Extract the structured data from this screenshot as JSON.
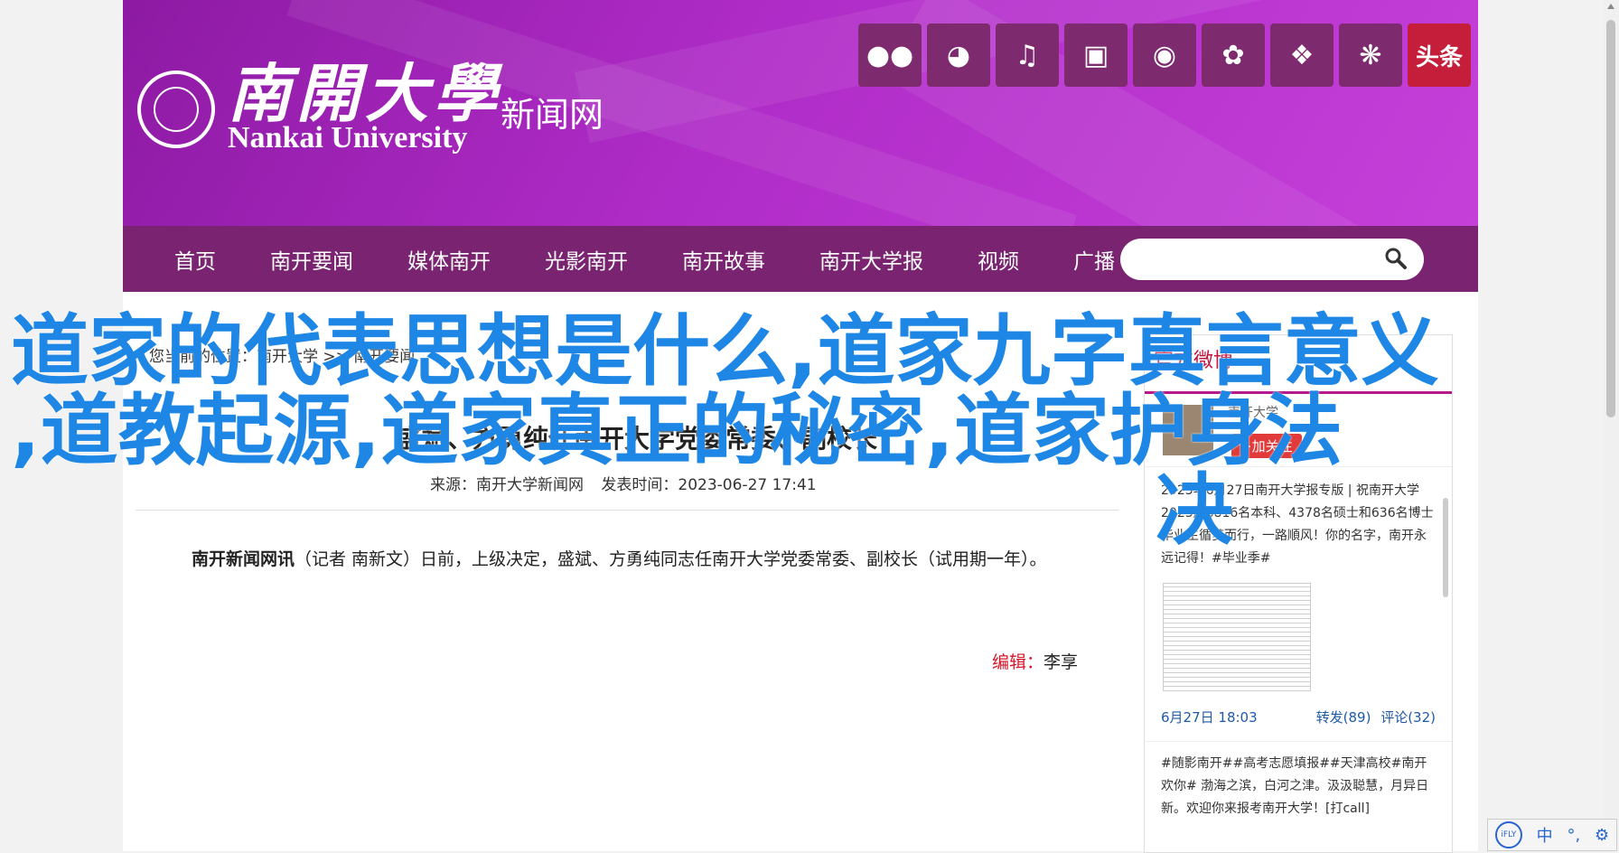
{
  "header": {
    "logo_cn": "南開大學",
    "logo_en": "Nankai University",
    "logo_sub": "新闻网",
    "social_icons": [
      "wechat-icon",
      "weibo-icon",
      "tiktok-icon",
      "bilibili-icon",
      "kuaishou-icon",
      "xuexi-icon",
      "dots-icon",
      "dandelion-icon",
      "toutiao-icon"
    ],
    "toutiao_label": "头条"
  },
  "nav": {
    "items": [
      "首页",
      "南开要闻",
      "媒体南开",
      "光影南开",
      "南开故事",
      "南开大学报",
      "视频",
      "广播"
    ],
    "search_placeholder": ""
  },
  "article": {
    "breadcrumb": "您当前的位置：南开大学 >> 南开要闻",
    "title": "盛斌、方勇纯任南开大学党委常委、副校长",
    "source": "来源：南开大学新闻网",
    "published": "发表时间：2023-06-27 17:41",
    "lead_bold": "南开新闻网讯",
    "lead_text": "（记者 南新文）日前，上级决定，盛斌、方勇纯同志任南开大学党委常委、副校长（试用期一年）。",
    "editor_label": "编辑：",
    "editor_name": "李享"
  },
  "sidebar": {
    "title": "官方微博",
    "account": "南开大学",
    "follow": "+加关注",
    "post1": "2023年6月27日南开大学报专版 | 祝南开大学2023届8816名本科、4378名硕士和636名博士毕业生循梦而行，一路順风！你的名字，南开永远记得！#毕业季#",
    "post1_date": "6月27日 18:03",
    "post1_repost": "转发(89)",
    "post1_comment": "评论(32)",
    "post2": "#随影南开##高考志愿填报##天津高校#南开欢你# 渤海之滨，白河之津。汲汲聪慧，月异日新。欢迎你来报考南开大学！[打call]"
  },
  "overlay": {
    "line1": "道家的代表思想是什么,道家九字真言意义",
    "line2": ",道教起源,道家真正的秘密,道家护身法",
    "line3": "决"
  },
  "ime": {
    "lang": "中"
  }
}
